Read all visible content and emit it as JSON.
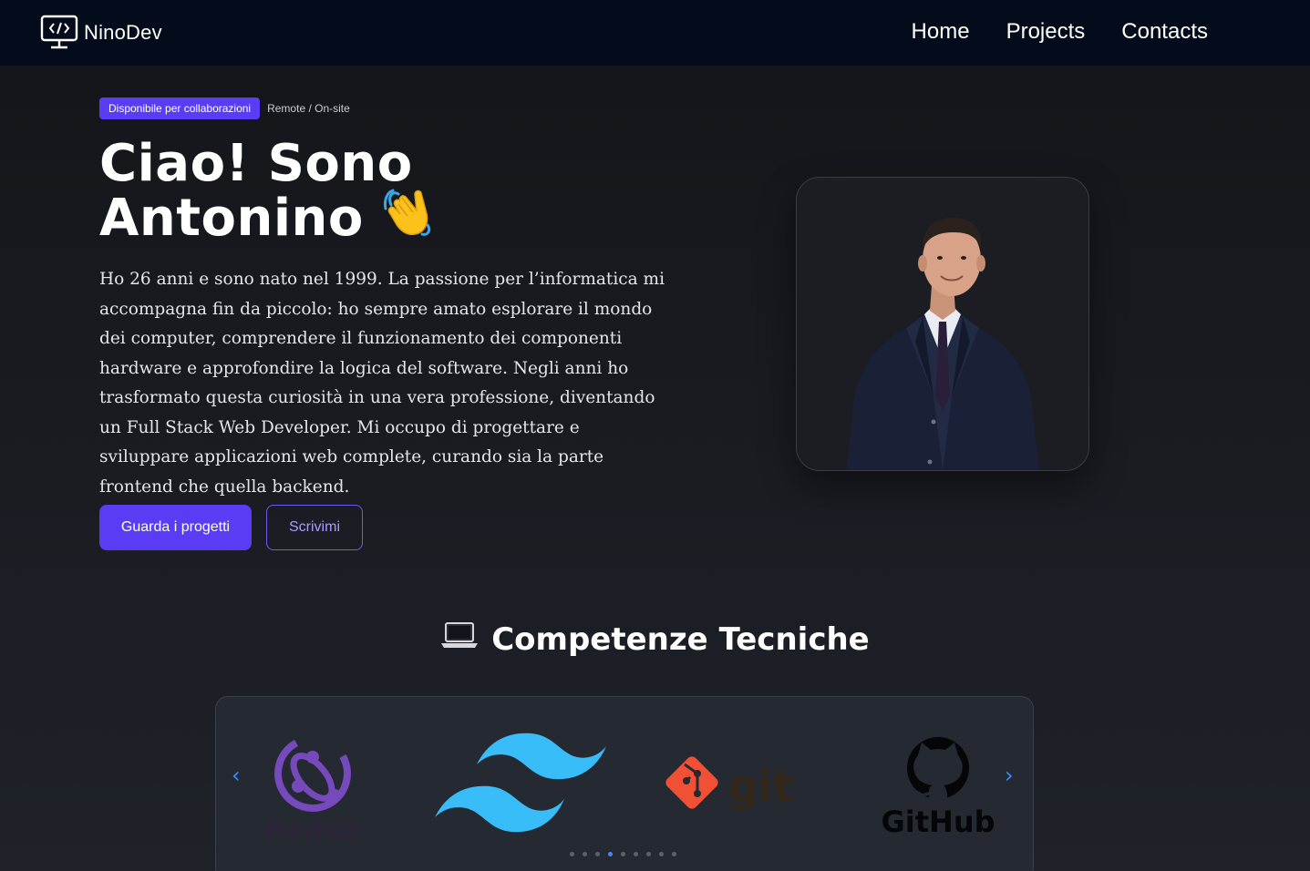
{
  "navbar": {
    "brand": "NinoDev",
    "brand_icon": "code-monitor-icon",
    "links": [
      "Home",
      "Projects",
      "Contacts"
    ]
  },
  "hero": {
    "badge": "Disponibile per collaborazioni",
    "badge_note": "Remote / On-site",
    "title_line1": "Ciao! Sono",
    "title_line2": "Antonino",
    "title_emoji": "waving-hand-icon",
    "description": "Ho 26 anni e sono nato nel 1999. La passione per l’informatica mi accompagna fin da piccolo: ho sempre amato esplorare il mondo dei computer, comprendere il funzionamento dei componenti hardware e approfondire la logica del software. Negli anni ho trasformato questa curiosità in una vera professione, diventando un Full Stack Web Developer. Mi occupo di progettare e sviluppare applicazioni web complete, curando sia la parte frontend che quella backend.",
    "primary_button": "Guarda i progetti",
    "secondary_button": "Scrivimi"
  },
  "skills": {
    "title": "Competenze Tecniche",
    "title_icon": "laptop-icon",
    "prev_arrow": "‹",
    "next_arrow": "›",
    "logos": [
      {
        "name": "Redux",
        "icon": "redux-logo"
      },
      {
        "name": "Tailwind CSS",
        "icon": "tailwind-logo"
      },
      {
        "name": "git",
        "icon": "git-logo"
      },
      {
        "name": "GitHub",
        "icon": "github-logo"
      }
    ],
    "dots_count": 9,
    "active_dot": 3
  },
  "colors": {
    "accent": "#5b3cf5",
    "nav_bg": "#040c1c",
    "carousel_arrow": "#3d8bfd",
    "tailwind": "#38bdf8",
    "redux": "#764abc",
    "git": "#f05033"
  }
}
